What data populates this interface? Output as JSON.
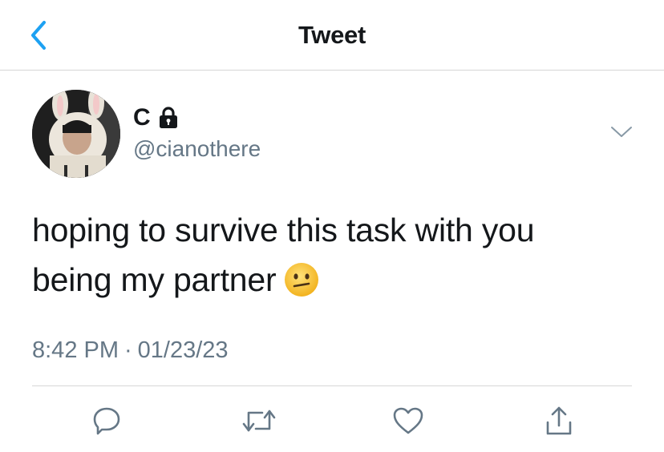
{
  "nav": {
    "title": "Tweet",
    "back_icon": "chevron-left-icon"
  },
  "author": {
    "display_name": "C",
    "handle": "@cianothere",
    "protected_icon": "lock-icon"
  },
  "tweet": {
    "text_line1": "hoping to survive this task with you",
    "text_line2": "being my partner",
    "emoji": "neutral-face"
  },
  "meta": {
    "time": "8:42 PM",
    "separator": "·",
    "date": "01/23/23"
  },
  "actions": [
    "reply-icon",
    "retweet-icon",
    "like-icon",
    "share-icon"
  ],
  "colors": {
    "accent": "#1da1f2",
    "text": "#14171a",
    "secondary": "#657786",
    "border": "#d6d6d6"
  }
}
